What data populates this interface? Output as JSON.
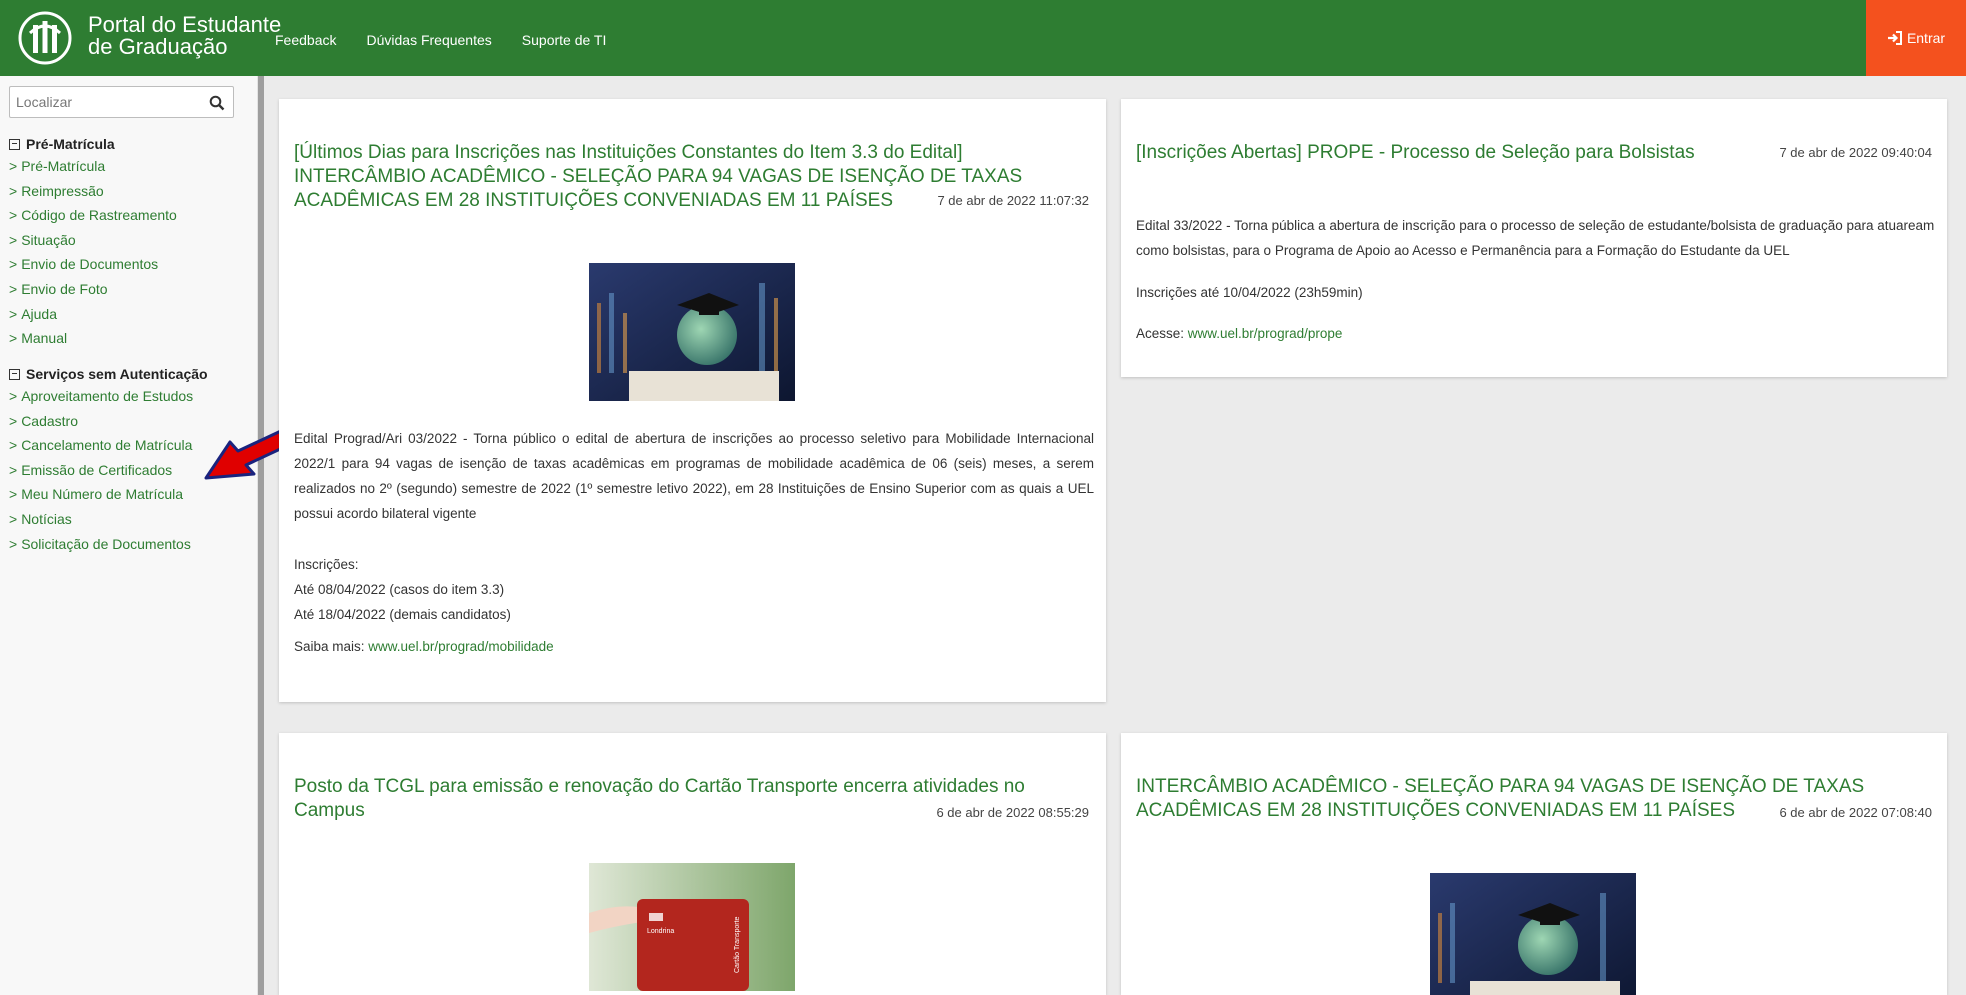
{
  "header": {
    "brand_line1": "Portal do Estudante",
    "brand_line2": "de Graduação",
    "nav": [
      "Feedback",
      "Dúvidas Frequentes",
      "Suporte de TI"
    ],
    "login_label": "Entrar",
    "colors": {
      "green": "#2e7d32",
      "login": "#f4511e"
    }
  },
  "sidebar": {
    "search_placeholder": "Localizar",
    "section1_title": "Pré-Matrícula",
    "section1_items": [
      "Pré-Matrícula",
      "Reimpressão",
      "Código de Rastreamento",
      "Situação",
      "Envio de Documentos",
      "Envio de Foto",
      "Ajuda",
      "Manual"
    ],
    "section2_title": "Serviços sem Autenticação",
    "section2_items": [
      "Aproveitamento de Estudos",
      "Cadastro",
      "Cancelamento de Matrícula",
      "Emissão de Certificados",
      "Meu Número de Matrícula",
      "Notícias",
      "Solicitação de Documentos"
    ]
  },
  "news": [
    {
      "title": "[Últimos Dias para Inscrições nas Instituições Constantes do Item 3.3 do Edital] INTERCÂMBIO ACADÊMICO - SELEÇÃO PARA 94 VAGAS DE ISENÇÃO DE TAXAS ACADÊMICAS EM 28 INSTITUIÇÕES CONVENIADAS EM 11 PAÍSES",
      "date": "7 de abr de 2022 11:07:32",
      "paragraph": "Edital Prograd/Ari 03/2022 - Torna público o edital de abertura de inscrições ao processo seletivo para Mobilidade Internacional 2022/1 para 94 vagas de isenção de taxas acadêmicas em programas de mobilidade acadêmica de 06 (seis) meses, a serem realizados no 2º (segundo) semestre de 2022 (1º semestre letivo 2022), em 28 Instituições de Ensino Superior com as quais a UEL possui acordo bilateral vigente",
      "inscricoes_label": "Inscrições:",
      "line1": "Até 08/04/2022 (casos do item 3.3)",
      "line2": "Até 18/04/2022 (demais candidatos)",
      "more_label": "Saiba mais: ",
      "more_link": "www.uel.br/prograd/mobilidade"
    },
    {
      "title": "[Inscrições Abertas] PROPE - Processo de Seleção para Bolsistas",
      "date": "7 de abr de 2022 09:40:04",
      "paragraph": "Edital 33/2022 - Torna pública a abertura de inscrição para o processo de seleção de estudante/bolsista de graduação para atuaream como bolsistas, para o Programa de Apoio ao Acesso e Permanência para a Formação do Estudante da UEL",
      "line1": "Inscrições até 10/04/2022 (23h59min)",
      "more_label": "Acesse: ",
      "more_link": "www.uel.br/prograd/prope"
    },
    {
      "title": "Posto da TCGL para emissão e renovação do Cartão Transporte encerra atividades no Campus",
      "date": "6 de abr de 2022 08:55:29"
    },
    {
      "title": "INTERCÂMBIO ACADÊMICO - SELEÇÃO PARA 94 VAGAS DE ISENÇÃO DE TAXAS ACADÊMICAS EM 28 INSTITUIÇÕES CONVENIADAS EM 11 PAÍSES",
      "date": "6 de abr de 2022 07:08:40"
    }
  ],
  "card_image_text": {
    "city": "Londrina",
    "card": "Cartão Transporte"
  }
}
